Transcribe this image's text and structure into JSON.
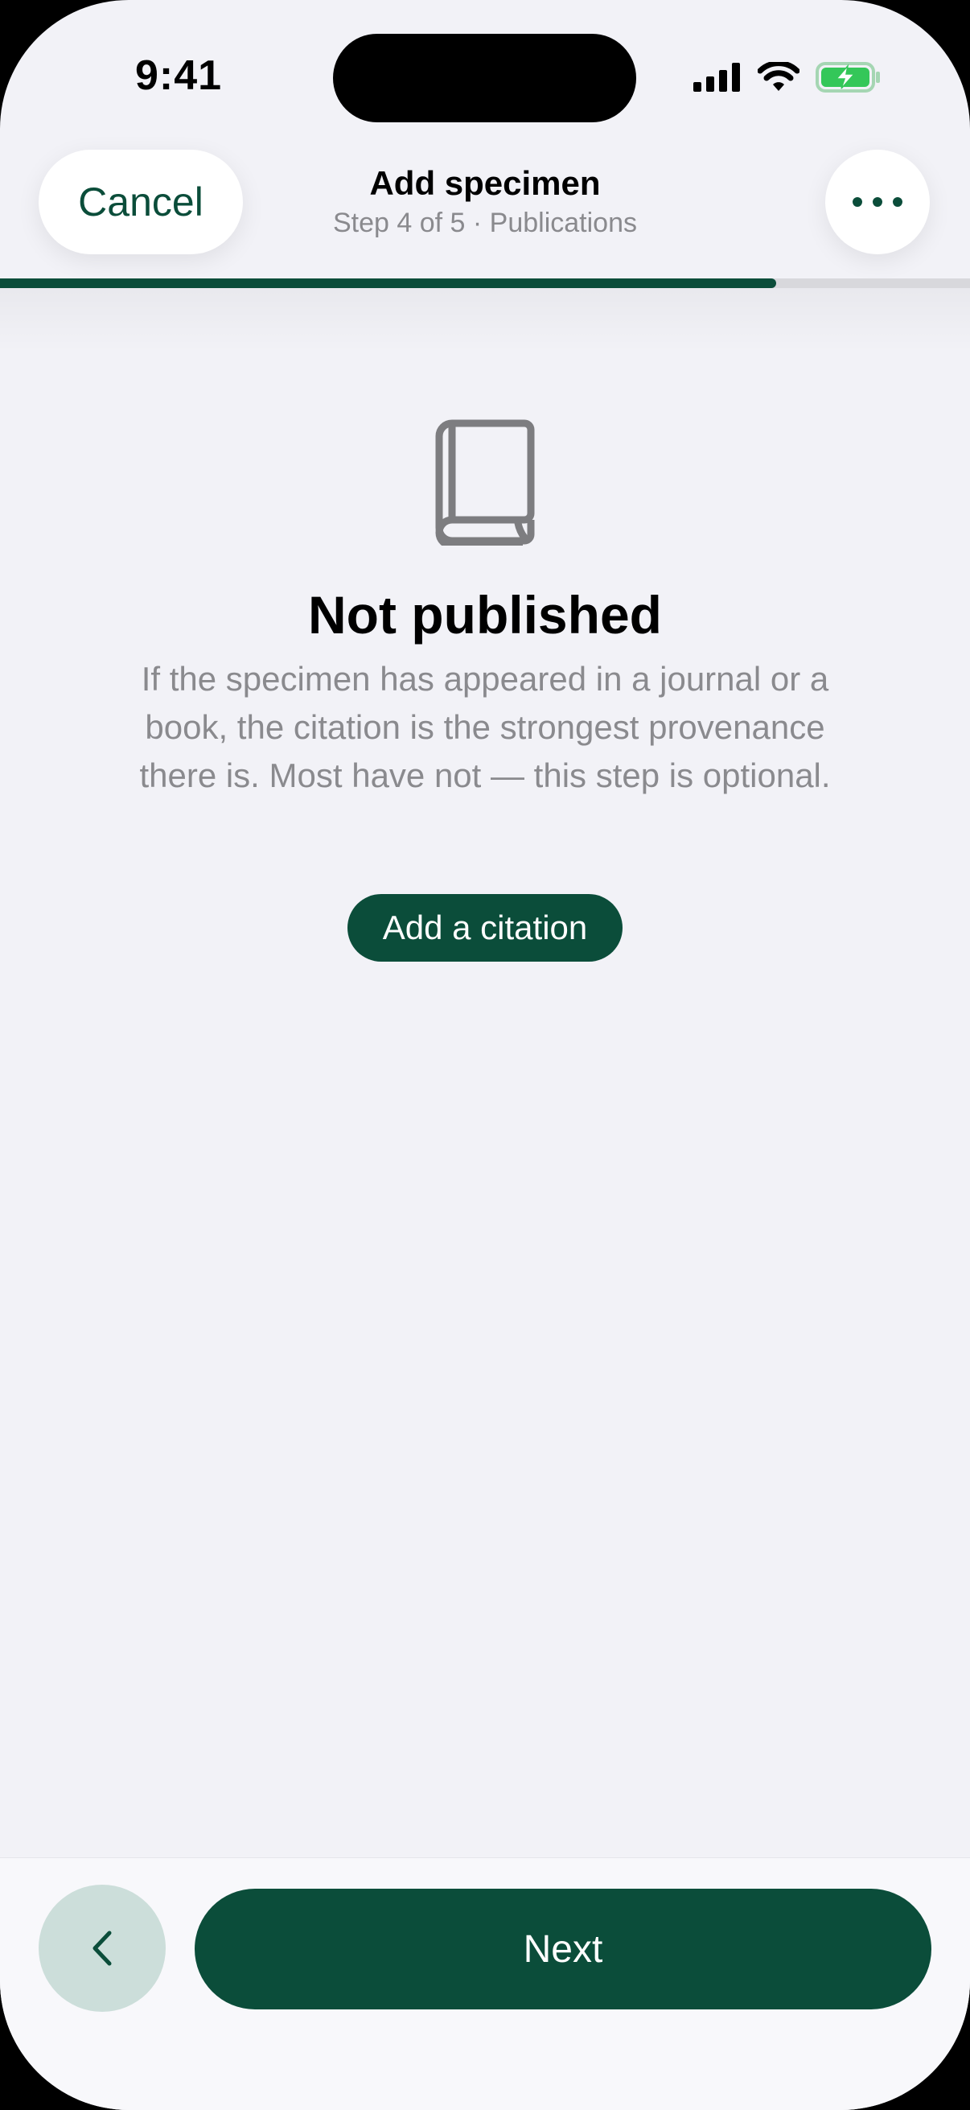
{
  "status_bar": {
    "time": "9:41"
  },
  "header": {
    "cancel_label": "Cancel",
    "title": "Add specimen",
    "subtitle": "Step 4 of 5 · Publications",
    "more_icon": "more-horizontal-icon"
  },
  "progress": {
    "current_step": 4,
    "total_steps": 5,
    "fraction": 0.8
  },
  "empty_state": {
    "icon": "book-icon",
    "title": "Not published",
    "body": "If the specimen has appeared in a journal or a book, the citation is the strongest provenance there is. Most have not — this step is optional.",
    "action_label": "Add a citation"
  },
  "footer": {
    "back_icon": "chevron-left-icon",
    "next_label": "Next"
  },
  "colors": {
    "accent": "#0b4d3a",
    "background": "#f2f2f7",
    "secondary_text": "#8a8a8e",
    "back_button_bg": "#ccdeda",
    "battery_green": "#34c759"
  }
}
